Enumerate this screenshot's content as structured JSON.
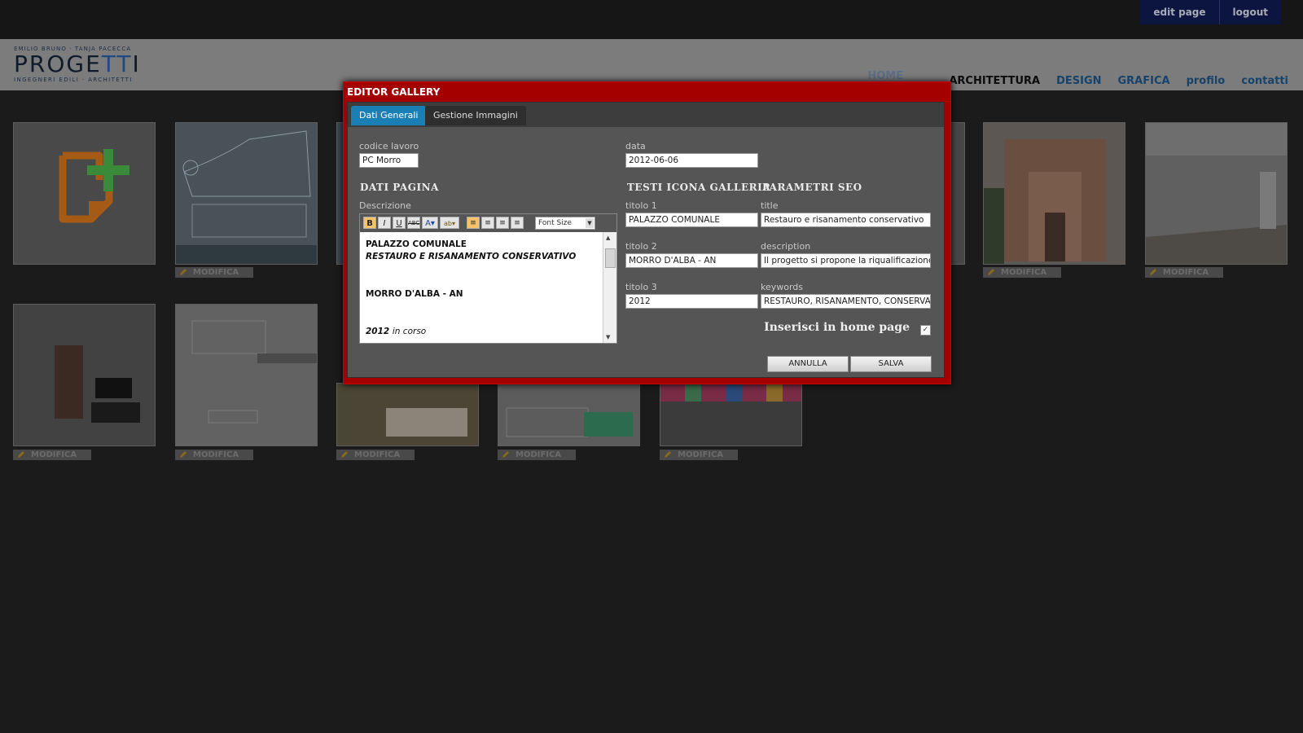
{
  "admin": {
    "edit_page": "edit page",
    "logout": "logout"
  },
  "logo": {
    "top": "EMILIO BRUNO · TANJA PACECCA",
    "main_a": "PROGE",
    "main_b": "TT",
    "main_c": "I",
    "bottom": "INGEGNERI EDILI · ARCHITETTI"
  },
  "nav": {
    "home": "HOME",
    "items": [
      "ARCHITETTURA",
      "DESIGN",
      "GRAFICA",
      "profilo",
      "contatti"
    ]
  },
  "gallery": {
    "edit_label": "MODIFICA"
  },
  "modal": {
    "title": "EDITOR GALLERY",
    "tabs": [
      "Dati Generali",
      "Gestione Immagini"
    ],
    "codice_lavoro_label": "codice lavoro",
    "codice_lavoro_value": "PC Morro",
    "data_label": "data",
    "data_value": "2012-06-06",
    "dati_pagina_heading": "DATI PAGINA",
    "descrizione_label": "Descrizione",
    "font_size_placeholder": "Font Size",
    "description_lines": [
      "PALAZZO COMUNALE",
      "RESTAURO E RISANAMENTO CONSERVATIVO",
      "MORRO D'ALBA - AN",
      "2012",
      "in corso"
    ],
    "testi_icona_heading": "TESTI ICONA GALLERIA",
    "parametri_seo_heading": "PARAMETRI SEO",
    "titolo1_label": "titolo 1",
    "titolo1_value": "PALAZZO COMUNALE",
    "titolo2_label": "titolo 2",
    "titolo2_value": "MORRO D'ALBA - AN",
    "titolo3_label": "titolo 3",
    "titolo3_value": "2012",
    "seo_title_label": "title",
    "seo_title_value": "Restauro e risanamento conservativo",
    "seo_description_label": "description",
    "seo_description_value": "Il progetto si propone la riqualificazione",
    "seo_keywords_label": "keywords",
    "seo_keywords_value": "RESTAURO, RISANAMENTO, CONSERVATIVO",
    "homepage_label": "Inserisci in home page",
    "homepage_checked": "✓",
    "cancel_label": "ANNULLA",
    "save_label": "SALVA"
  }
}
